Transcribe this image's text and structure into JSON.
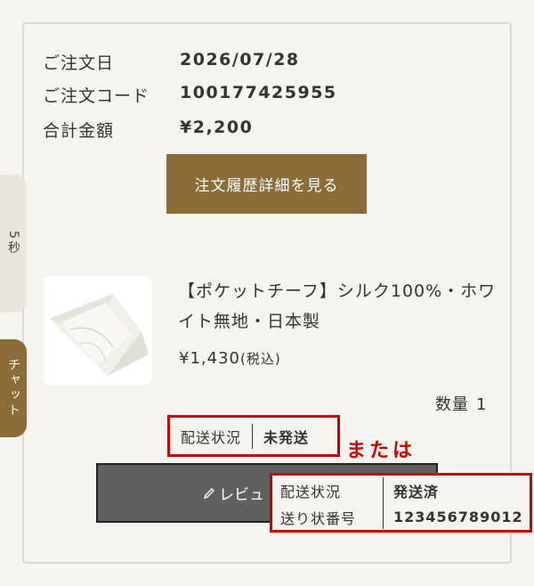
{
  "timer_tab": {
    "label": "5秒"
  },
  "chat_tab": {
    "label": "チャット"
  },
  "order": {
    "date_label": "ご注文日",
    "date_value": "2026/07/28",
    "code_label": "ご注文コード",
    "code_value": "100177425955",
    "total_label": "合計金額",
    "total_value": "¥2,200",
    "detail_button": "注文履歴詳細を見る"
  },
  "item": {
    "name": "【ポケットチーフ】シルク100%・ホワイト無地・日本製",
    "price": "¥1,430",
    "tax_note": "(税込)",
    "qty_label": "数量",
    "qty_value": "1"
  },
  "status": {
    "label": "配送状況",
    "value": "未発送"
  },
  "or_text": "または",
  "review_button": "レビュ",
  "shipped": {
    "status_label": "配送状況",
    "status_value": "発送済",
    "tracking_label": "送り状番号",
    "tracking_value": "123456789012"
  },
  "colors": {
    "accent_brown": "#8b6b36",
    "highlight_red": "#cc0000",
    "background": "#f7f4ef"
  }
}
